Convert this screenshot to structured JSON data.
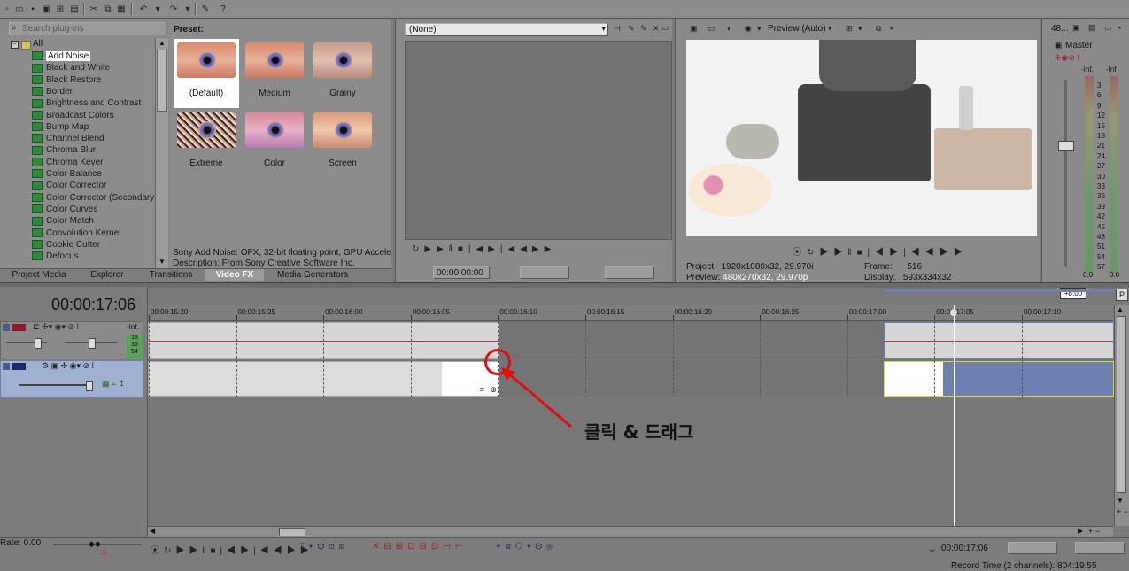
{
  "plugins": {
    "search_placeholder": "Search plug-ins",
    "root": "All",
    "items": [
      "Add Noise",
      "Black and White",
      "Black Restore",
      "Border",
      "Brightness and Contrast",
      "Broadcast Colors",
      "Bump Map",
      "Channel Blend",
      "Chroma Blur",
      "Chroma Keyer",
      "Color Balance",
      "Color Corrector",
      "Color Corrector (Secondary)",
      "Color Curves",
      "Color Match",
      "Convolution Kernel",
      "Cookie Cutter",
      "Defocus"
    ],
    "selected": "Add Noise"
  },
  "tabs": [
    "Project Media",
    "Explorer",
    "Transitions",
    "Video FX",
    "Media Generators"
  ],
  "active_tab": "Video FX",
  "preset": {
    "title": "Preset:",
    "items": [
      "(Default)",
      "Medium",
      "Grainy",
      "Extreme",
      "Color",
      "Screen"
    ],
    "info_line1": "Sony Add Noise: OFX, 32-bit floating point, GPU Accelera",
    "info_line2": "Description: From Sony Creative Software Inc."
  },
  "trimmer": {
    "dropdown_value": "(None)",
    "timecode": "00:00:00:00"
  },
  "preview": {
    "mode": "Preview (Auto)",
    "project_label": "Project:",
    "project_value": "1920x1080x32, 29.970i",
    "preview_label": "Preview:",
    "preview_value": "480x270x32, 29.970p",
    "frame_label": "Frame:",
    "frame_value": "516",
    "display_label": "Display:",
    "display_value": "593x334x32"
  },
  "master": {
    "title": "Master",
    "top_value": "48...",
    "inf_left": "-Inf.",
    "inf_right": "-Inf.",
    "scale": [
      "3",
      "6",
      "9",
      "12",
      "15",
      "18",
      "21",
      "24",
      "27",
      "30",
      "33",
      "36",
      "39",
      "42",
      "45",
      "48",
      "51",
      "54",
      "57"
    ],
    "bottom_left": "0.0",
    "bottom_right": "0.0"
  },
  "timeline": {
    "timecode": "00:00:17:06",
    "offset_badge": "+8:00",
    "ticks": [
      "00:00:15:20",
      "00:00:15:25",
      "00:00:16:00",
      "00:00:16:05",
      "00:00:16:10",
      "00:00:16:15",
      "00:00:16:20",
      "00:00:16:25",
      "00:00:17:00",
      "00:00:17:05",
      "00:00:17:10"
    ],
    "audio_level": "-Inf.",
    "audio_meter": [
      "18",
      "36",
      "54"
    ],
    "annotation": "클릭 & 드래그"
  },
  "bottom": {
    "rate": "Rate: 0.00",
    "timecode": "00:00:17:06",
    "record_time": "Record Time (2 channels): 804:19:55"
  },
  "colors": {
    "accent_blue": "#6b7fb0",
    "annotation_red": "#e01010",
    "selection_yellow": "#d8e030",
    "fx_green": "#2c8a3a"
  }
}
